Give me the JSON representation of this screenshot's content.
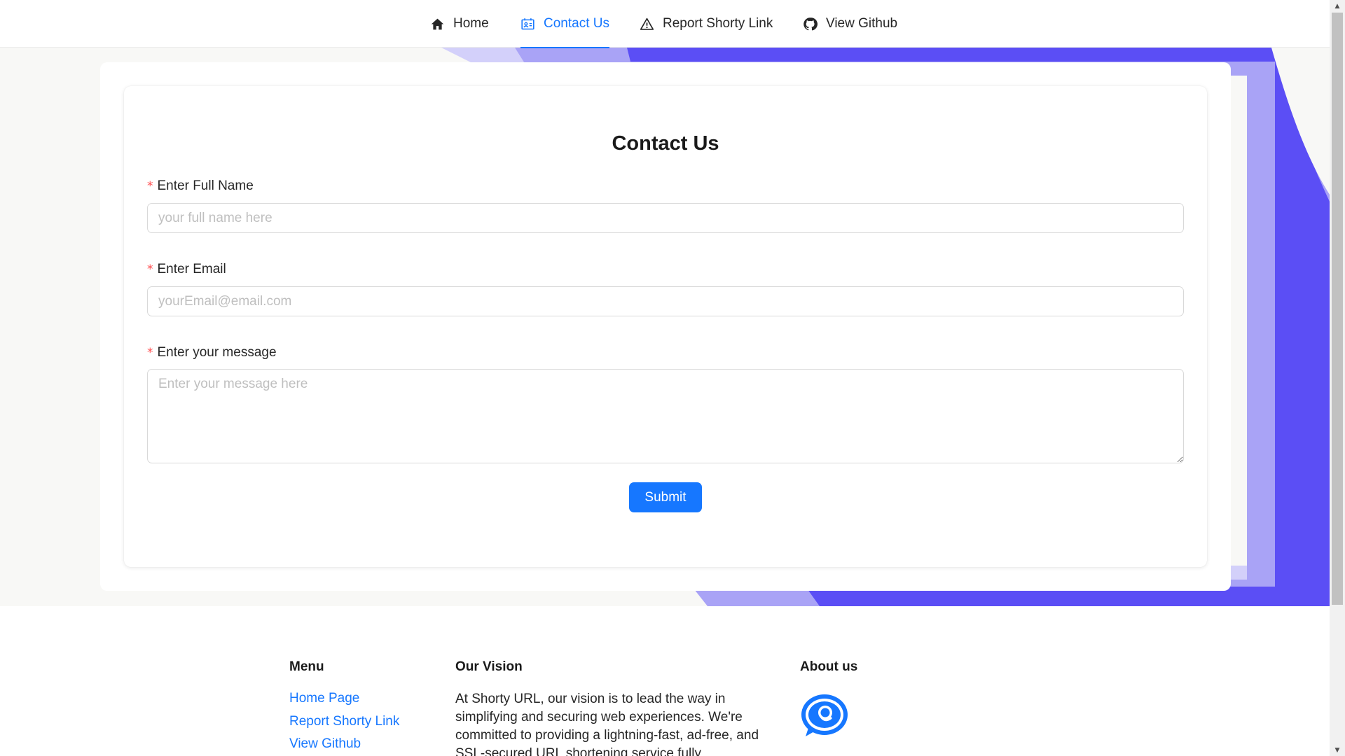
{
  "nav": {
    "items": [
      {
        "label": "Home",
        "icon": "home-icon"
      },
      {
        "label": "Contact Us",
        "icon": "contact-card-icon",
        "active": true
      },
      {
        "label": "Report Shorty Link",
        "icon": "warning-icon"
      },
      {
        "label": "View Github",
        "icon": "github-icon"
      }
    ]
  },
  "form": {
    "title": "Contact Us",
    "name_label": "Enter Full Name",
    "name_placeholder": "your full name here",
    "email_label": "Enter Email",
    "email_placeholder": "yourEmail@email.com",
    "message_label": "Enter your message",
    "message_placeholder": "Enter your message here",
    "required_mark": "*",
    "submit_label": "Submit"
  },
  "footer": {
    "menu": {
      "title": "Menu",
      "links": [
        "Home Page",
        "Report Shorty Link",
        "View Github"
      ]
    },
    "vision": {
      "title": "Our Vision",
      "text": "At Shorty URL, our vision is to lead the way in simplifying and securing web experiences. We're committed to providing a lightning-fast, ad-free, and SSL-secured URL shortening service fully"
    },
    "about": {
      "title": "About us",
      "logo_icon": "chat-bubble-logo-icon"
    }
  },
  "colors": {
    "accent": "#1677ff",
    "hero_purple": "#5b4ef5",
    "required": "#ff4d4f"
  }
}
